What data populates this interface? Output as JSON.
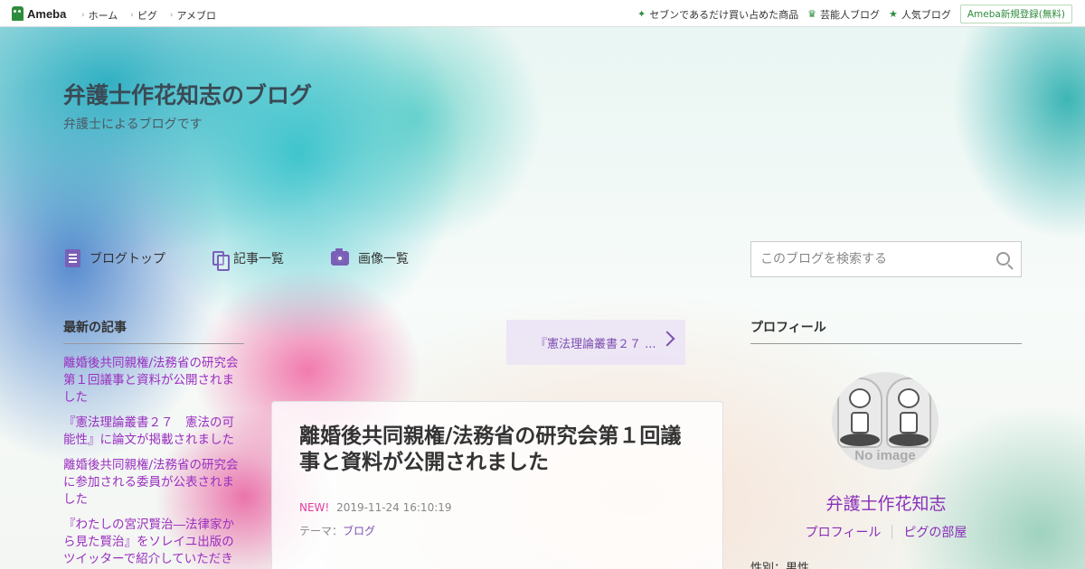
{
  "topbar": {
    "logo_text": "Ameba",
    "nav": [
      "ホーム",
      "ピグ",
      "アメブロ"
    ],
    "right_items": [
      {
        "icon": "sparkle-icon",
        "label": "セブンであるだけ買い占めた商品"
      },
      {
        "icon": "crown-icon",
        "label": "芸能人ブログ"
      },
      {
        "icon": "star-icon",
        "label": "人気ブログ"
      }
    ],
    "register_label": "Ameba新規登録(無料)"
  },
  "header": {
    "title": "弁護士作花知志のブログ",
    "description": "弁護士によるブログです"
  },
  "nav": {
    "items": [
      {
        "icon": "document-icon",
        "label": "ブログトップ"
      },
      {
        "icon": "copy-icon",
        "label": "記事一覧"
      },
      {
        "icon": "camera-icon",
        "label": "画像一覧"
      }
    ]
  },
  "search": {
    "placeholder": "このブログを検索する"
  },
  "sidebar_left": {
    "heading": "最新の記事",
    "items": [
      "離婚後共同親権/法務省の研究会第１回議事と資料が公開されました",
      "『憲法理論叢書２７　憲法の可能性』に論文が掲載されました",
      "離婚後共同親権/法務省の研究会に参加される委員が公表されました",
      "『わたしの宮沢賢治―法律家から見た賢治』をソレイユ出版のツイッターで紹介していただき"
    ]
  },
  "pager": {
    "next_label": "『憲法理論叢書２７ ..."
  },
  "article": {
    "title": "離婚後共同親権/法務省の研究会第１回議事と資料が公開されました",
    "new_badge": "NEW!",
    "timestamp": "2019-11-24 16:10:19",
    "theme_label": "テーマ：",
    "theme_value": "ブログ"
  },
  "profile": {
    "heading": "プロフィール",
    "no_image_text": "No image",
    "name": "弁護士作花知志",
    "link_profile": "プロフィール",
    "link_pig_room": "ピグの部屋",
    "gender": "性別：男性"
  },
  "colors": {
    "accent_purple": "#8a2fb8",
    "ameba_green": "#2d8c3c"
  }
}
